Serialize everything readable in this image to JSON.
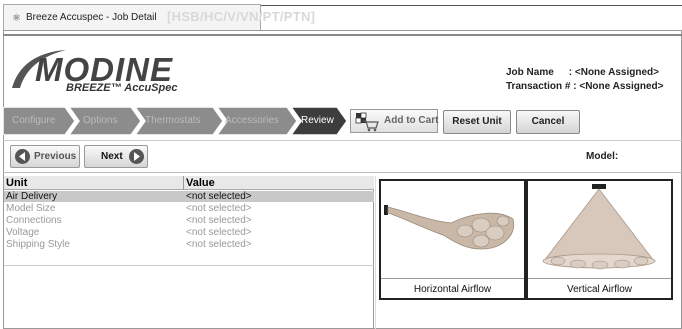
{
  "window": {
    "tab_title": "Breeze Accuspec - Job Detail",
    "overlay_code": "[HSB/HC/V/VN/PT/PTN]"
  },
  "logo": {
    "word": "MODINE",
    "sub": "BREEZE™ AccuSpec"
  },
  "job": {
    "name_label": "Job Name",
    "name_value": ": <None Assigned>",
    "transaction_label": "Transaction # :",
    "transaction_value": "<None Assigned>"
  },
  "wizard": {
    "steps": [
      {
        "label": "Configure"
      },
      {
        "label": "Options"
      },
      {
        "label": "Thermostats"
      },
      {
        "label": "Accessories"
      },
      {
        "label": "Review"
      }
    ],
    "add_to_cart": "Add to Cart",
    "reset_unit": "Reset Unit",
    "cancel": "Cancel"
  },
  "nav": {
    "previous": "Previous",
    "next": "Next",
    "model_label": "Model:"
  },
  "table": {
    "headers": [
      "Unit",
      "Value"
    ],
    "rows": [
      {
        "unit": "Air Delivery",
        "value": "<not selected>"
      },
      {
        "unit": "Model Size",
        "value": "<not selected>"
      },
      {
        "unit": "Connections",
        "value": "<not selected>"
      },
      {
        "unit": "Voltage",
        "value": "<not selected>"
      },
      {
        "unit": "Shipping Style",
        "value": "<not selected>"
      }
    ]
  },
  "options": [
    {
      "caption": "Horizontal Airflow",
      "icon": "horizontal-airflow-image"
    },
    {
      "caption": "Vertical Airflow",
      "icon": "vertical-airflow-image"
    }
  ],
  "colors": {
    "wizard_dark": "#3d3d3d",
    "wizard_light": "#8c8c8c",
    "selected_row": "#c8c8c8"
  }
}
